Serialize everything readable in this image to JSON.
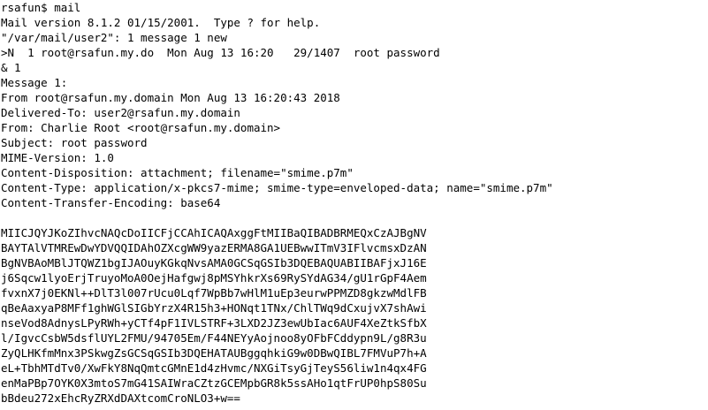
{
  "terminal": {
    "lines": [
      "rsafun$ mail",
      "Mail version 8.1.2 01/15/2001.  Type ? for help.",
      "\"/var/mail/user2\": 1 message 1 new",
      ">N  1 root@rsafun.my.do  Mon Aug 13 16:20   29/1407  root password",
      "& 1",
      "Message 1:",
      "From root@rsafun.my.domain Mon Aug 13 16:20:43 2018",
      "Delivered-To: user2@rsafun.my.domain",
      "From: Charlie Root <root@rsafun.my.domain>",
      "Subject: root password",
      "MIME-Version: 1.0",
      "Content-Disposition: attachment; filename=\"smime.p7m\"",
      "Content-Type: application/x-pkcs7-mime; smime-type=enveloped-data; name=\"smime.p7m\"",
      "Content-Transfer-Encoding: base64",
      "",
      "MIICJQYJKoZIhvcNAQcDoIICFjCCAhICAQAxggFtMIIBaQIBADBRMEQxCzAJBgNV",
      "BAYTAlVTMREwDwYDVQQIDAhOZXcgWW9yazERMA8GA1UEBwwITmV3IFlvcmsxDzAN",
      "BgNVBAoMBlJTQWZ1bgIJAOuyKGkqNvsAMA0GCSqGSIb3DQEBAQUABIIBAFjxJ16E",
      "j6Sqcw1lyoErjTruyoMoA0OejHafgwj8pMSYhkrXs69RySYdAG34/gU1rGpF4Aem",
      "fvxnX7j0EKNl++DlT3l007rUcu0Lqf7WpBb7wHlM1uEp3eurwPPMZD8gkzwMdlFB",
      "qBeAaxyaP8MFf1ghWGlSIGbYrzX4R15h3+HONqt1TNx/ChlTWq9dCxujvX7shAwi",
      "nseVod8AdnysLPyRWh+yCTf4pF1IVLSTRF+3LXD2JZ3ewUbIac6AUF4XeZtkSfbX",
      "l/IgvcCsbW5dsflUYL2FMU/94705Em/F44NEYyAojnoo8yOFbFCddypn9L/g8R3u",
      "ZyQLHKfmMnx3PSkwgZsGCSqGSIb3DQEHATAUBggqhkiG9w0DBwQIBL7FMVuP7h+A",
      "eL+TbhMTdTv0/XwFkY8NqQmtcGMnE1d4zHvmc/NXGiTsyGjTeyS56liw1n4qx4FG",
      "enMaPBp7OYK0X3mtoS7mG41SAIWraCZtzGCEMpbGR8k5ssAHo1qtFrUP0hpS80Su",
      "bBdeu272xEhcRyZRXdDAXtcomCroNLO3+w=="
    ]
  }
}
